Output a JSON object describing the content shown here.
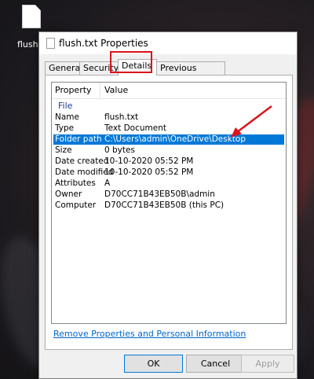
{
  "desktop": {
    "file_label": "flush.t"
  },
  "window": {
    "title": "flush.txt Properties"
  },
  "tabs": [
    {
      "label": "General"
    },
    {
      "label": "Security"
    },
    {
      "label": "Details"
    },
    {
      "label": "Previous Versions"
    }
  ],
  "details": {
    "header_property": "Property",
    "header_value": "Value",
    "group_label": "File",
    "rows": [
      {
        "key": "Name",
        "value": "flush.txt"
      },
      {
        "key": "Type",
        "value": "Text Document"
      },
      {
        "key": "Folder path",
        "value": "C:\\Users\\admin\\OneDrive\\Desktop",
        "selected": true
      },
      {
        "key": "Size",
        "value": "0 bytes"
      },
      {
        "key": "Date created",
        "value": "10-10-2020 05:52 PM"
      },
      {
        "key": "Date modified",
        "value": "10-10-2020 05:52 PM"
      },
      {
        "key": "Attributes",
        "value": "A"
      },
      {
        "key": "Owner",
        "value": "D70CC71B43EB50B\\admin"
      },
      {
        "key": "Computer",
        "value": "D70CC71B43EB50B (this PC)"
      }
    ]
  },
  "remove_link": "Remove Properties and Personal Information",
  "buttons": {
    "ok": "OK",
    "cancel": "Cancel",
    "apply": "Apply"
  },
  "colors": {
    "selection": "#0078d7",
    "annotation": "#d9141c",
    "link": "#0066cc"
  }
}
